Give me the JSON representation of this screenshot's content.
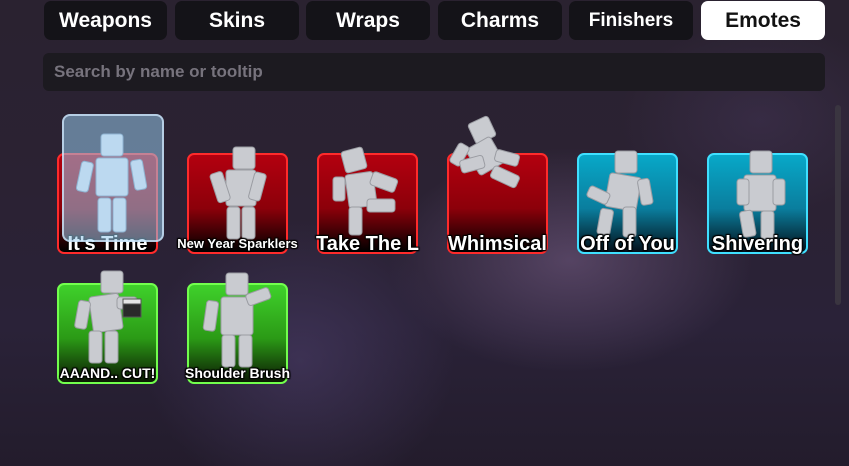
{
  "tabs": [
    {
      "label": "Weapons",
      "active": false
    },
    {
      "label": "Skins",
      "active": false
    },
    {
      "label": "Wraps",
      "active": false
    },
    {
      "label": "Charms",
      "active": false
    },
    {
      "label": "Finishers",
      "active": false
    },
    {
      "label": "Emotes",
      "active": true
    }
  ],
  "search": {
    "placeholder": "Search by name or tooltip",
    "value": ""
  },
  "emotes": [
    {
      "name": "It's Time",
      "rarity": "red",
      "selected": true
    },
    {
      "name": "New Year Sparklers",
      "rarity": "red"
    },
    {
      "name": "Take The L",
      "rarity": "red"
    },
    {
      "name": "Whimsical",
      "rarity": "red"
    },
    {
      "name": "Off of You",
      "rarity": "blue"
    },
    {
      "name": "Shivering",
      "rarity": "blue"
    },
    {
      "name": "AAAND.. CUT!",
      "rarity": "green"
    },
    {
      "name": "Shoulder Brush",
      "rarity": "green"
    }
  ],
  "colors": {
    "red": "#b3000f",
    "blue": "#08a8c8",
    "green": "#3fd12b",
    "figure": "#c9cbd0"
  }
}
